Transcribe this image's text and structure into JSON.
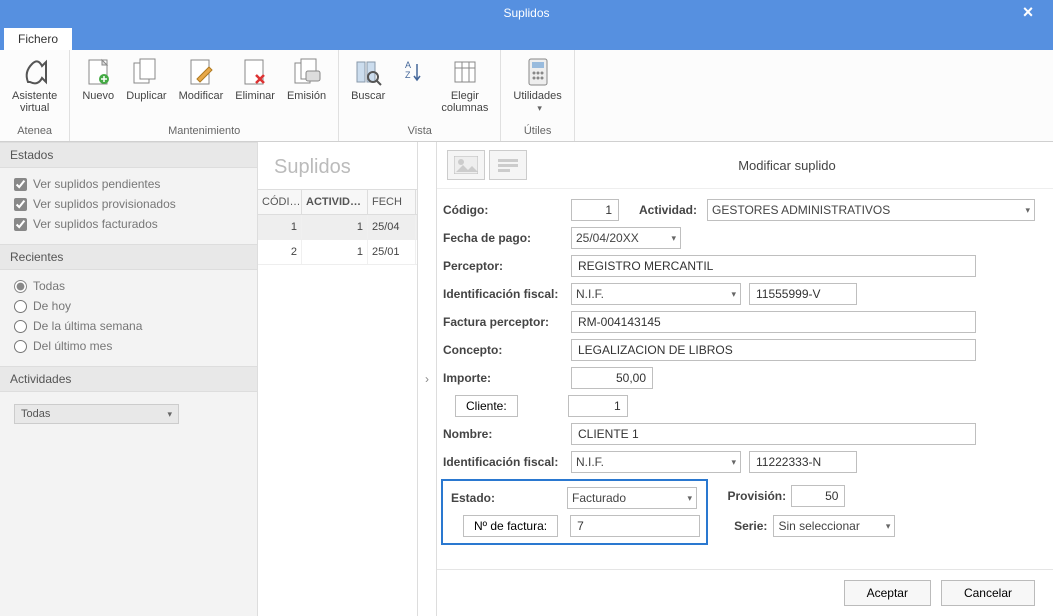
{
  "window": {
    "title": "Suplidos"
  },
  "tabs": {
    "fichero": "Fichero"
  },
  "ribbon": {
    "atenea": {
      "group": "Atenea",
      "asistente": "Asistente\nvirtual"
    },
    "mantenimiento": {
      "group": "Mantenimiento",
      "nuevo": "Nuevo",
      "duplicar": "Duplicar",
      "modificar": "Modificar",
      "eliminar": "Eliminar",
      "emision": "Emisión"
    },
    "vista": {
      "group": "Vista",
      "buscar": "Buscar",
      "sort": "",
      "elegir": "Elegir\ncolumnas"
    },
    "utiles": {
      "group": "Útiles",
      "utilidades": "Utilidades"
    }
  },
  "left": {
    "estados": {
      "header": "Estados",
      "pendientes": "Ver suplidos pendientes",
      "provisionados": "Ver suplidos provisionados",
      "facturados": "Ver suplidos facturados"
    },
    "recientes": {
      "header": "Recientes",
      "todas": "Todas",
      "hoy": "De hoy",
      "semana": "De la última semana",
      "mes": "Del último mes"
    },
    "actividades": {
      "header": "Actividades",
      "value": "Todas"
    }
  },
  "center": {
    "title": "Suplidos",
    "columns": {
      "codigo": "CÓDI…",
      "actividad": "ACTIVID…",
      "fecha": "FECH"
    },
    "rows": [
      {
        "codigo": "1",
        "actividad": "1",
        "fecha": "25/04"
      },
      {
        "codigo": "2",
        "actividad": "1",
        "fecha": "25/01"
      }
    ]
  },
  "form": {
    "title": "Modificar suplido",
    "labels": {
      "codigo": "Código:",
      "actividad": "Actividad:",
      "fechapago": "Fecha de pago:",
      "perceptor": "Perceptor:",
      "idfiscal": "Identificación fiscal:",
      "facturaperceptor": "Factura perceptor:",
      "concepto": "Concepto:",
      "importe": "Importe:",
      "cliente": "Cliente:",
      "nombre": "Nombre:",
      "estado": "Estado:",
      "nfactura": "Nº de factura:",
      "provision": "Provisión:",
      "serie": "Serie:"
    },
    "values": {
      "codigo": "1",
      "actividad": "GESTORES ADMINISTRATIVOS",
      "fechapago": "25/04/20XX",
      "perceptor": "REGISTRO MERCANTIL",
      "idfiscal_type": "N.I.F.",
      "idfiscal_num": "11555999-V",
      "facturaperceptor": "RM-004143145",
      "concepto": "LEGALIZACION DE LIBROS",
      "importe": "50,00",
      "cliente": "1",
      "nombre": "CLIENTE 1",
      "cliente_idfiscal_type": "N.I.F.",
      "cliente_idfiscal_num": "11222333-N",
      "estado": "Facturado",
      "nfactura": "7",
      "provision": "50",
      "serie": "Sin seleccionar"
    },
    "buttons": {
      "aceptar": "Aceptar",
      "cancelar": "Cancelar"
    }
  }
}
